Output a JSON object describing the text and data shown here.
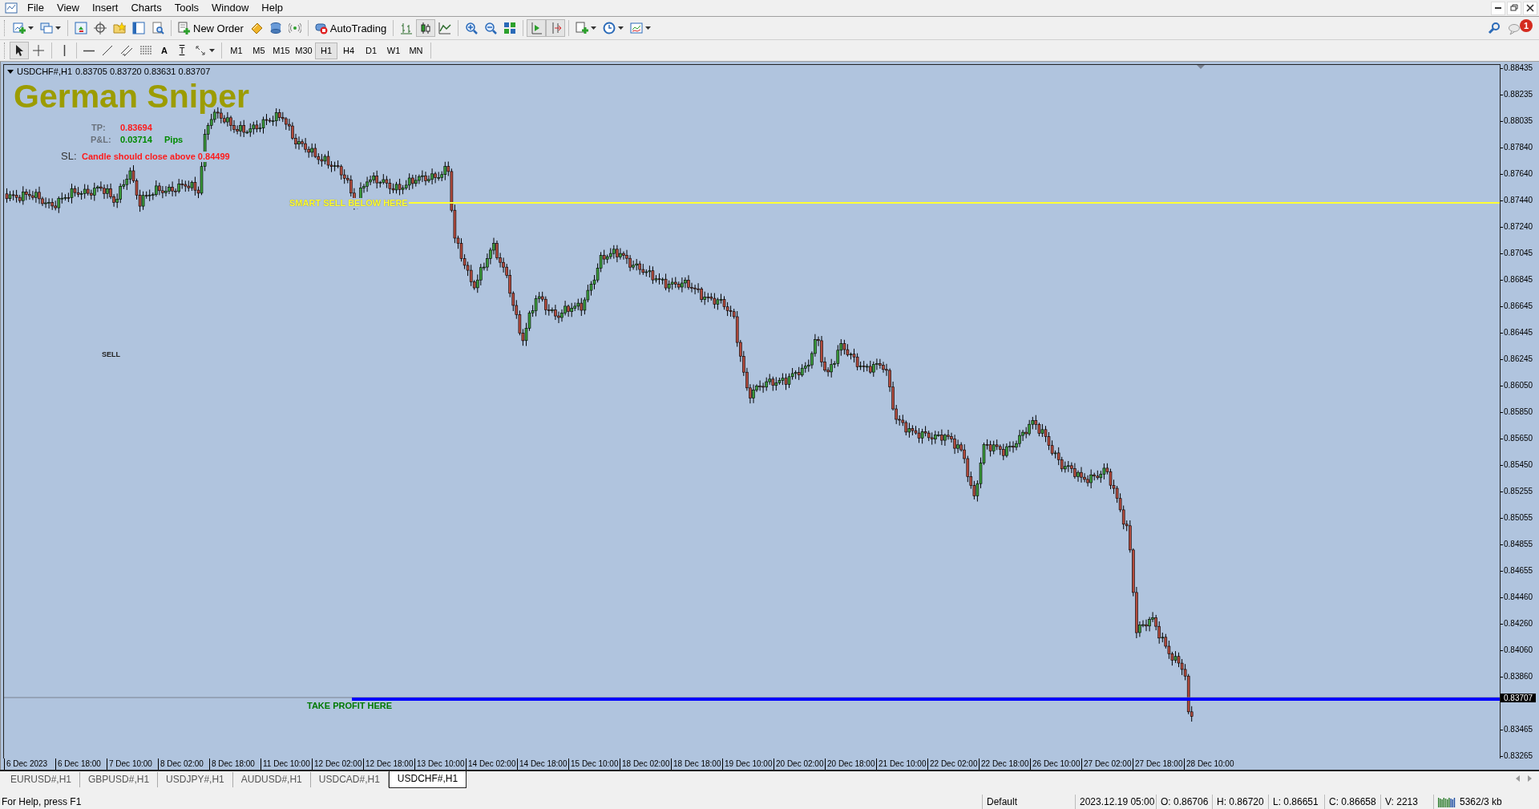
{
  "menu": [
    "File",
    "View",
    "Insert",
    "Charts",
    "Tools",
    "Window",
    "Help"
  ],
  "toolbar": [
    {
      "kind": "new-chart",
      "dropdown": true,
      "selected": false
    },
    {
      "kind": "profiles",
      "dropdown": true,
      "selected": false
    },
    {
      "kind": "market-watch",
      "selected": false
    },
    {
      "kind": "navigator",
      "selected": false
    },
    {
      "kind": "favorites",
      "selected": false
    },
    {
      "kind": "terminal",
      "selected": false
    },
    {
      "kind": "tester",
      "selected": false
    },
    {
      "kind": "new-order",
      "label": "New Order",
      "selected": false
    },
    {
      "kind": "editor",
      "selected": false
    },
    {
      "kind": "community",
      "selected": false
    },
    {
      "kind": "signals",
      "selected": false
    },
    {
      "kind": "autotrading",
      "label": "AutoTrading",
      "selected": false
    },
    {
      "kind": "bar-chart",
      "selected": false
    },
    {
      "kind": "candle-chart",
      "selected": true
    },
    {
      "kind": "line-chart",
      "selected": false
    },
    {
      "kind": "zoom-in",
      "selected": false
    },
    {
      "kind": "zoom-out",
      "selected": false
    },
    {
      "kind": "tile",
      "selected": false
    },
    {
      "kind": "autoscroll",
      "selected": true
    },
    {
      "kind": "chart-shift",
      "selected": true
    },
    {
      "kind": "indicators",
      "dropdown": true,
      "selected": false
    },
    {
      "kind": "periods",
      "dropdown": true,
      "selected": false
    },
    {
      "kind": "templates",
      "dropdown": true,
      "selected": false
    }
  ],
  "notifications": {
    "count": "1"
  },
  "drawing_tools": [
    {
      "kind": "cursor",
      "selected": true
    },
    {
      "kind": "crosshair",
      "selected": false
    },
    {
      "kind": "vline",
      "selected": false
    },
    {
      "kind": "hline",
      "selected": false
    },
    {
      "kind": "trendline",
      "selected": false
    },
    {
      "kind": "channel",
      "selected": false
    },
    {
      "kind": "fibo",
      "selected": false
    },
    {
      "kind": "text",
      "glyph": "A",
      "selected": false
    },
    {
      "kind": "label",
      "glyph": "T",
      "selected": false
    },
    {
      "kind": "arrows",
      "dropdown": true,
      "selected": false
    }
  ],
  "periods": [
    {
      "label": "M1",
      "selected": false
    },
    {
      "label": "M5",
      "selected": false
    },
    {
      "label": "M15",
      "selected": false
    },
    {
      "label": "M30",
      "selected": false
    },
    {
      "label": "H1",
      "selected": true
    },
    {
      "label": "H4",
      "selected": false
    },
    {
      "label": "D1",
      "selected": false
    },
    {
      "label": "W1",
      "selected": false
    },
    {
      "label": "MN",
      "selected": false
    }
  ],
  "chart": {
    "symbol": "USDCHF#,H1",
    "ohlc": "0.83705 0.83720 0.83631 0.83707",
    "indicator": {
      "title": "German Sniper",
      "tp_label": "TP:",
      "tp_value": "0.83694",
      "pnl_label": "P&L:",
      "pnl_value": "0.03714",
      "pnl_unit": "Pips",
      "sl_label": "SL:",
      "sl_text": "Candle should close above 0.84499"
    },
    "lines": [
      {
        "kind": "sell",
        "label": "SMART SELL BELOW HERE"
      },
      {
        "kind": "take-profit",
        "label": "TAKE PROFIT HERE"
      }
    ],
    "sell_marker": "SELL",
    "price_axis": [
      "0.88435",
      "0.88235",
      "0.88035",
      "0.87840",
      "0.87640",
      "0.87440",
      "0.87240",
      "0.87045",
      "0.86845",
      "0.86645",
      "0.86445",
      "0.86245",
      "0.86050",
      "0.85850",
      "0.85650",
      "0.85450",
      "0.85255",
      "0.85055",
      "0.84855",
      "0.84655",
      "0.84460",
      "0.84260",
      "0.84060",
      "0.83860",
      "0.83465",
      "0.83265"
    ],
    "current_price": "0.83707",
    "time_axis": [
      "6 Dec 2023",
      "6 Dec 18:00",
      "7 Dec 10:00",
      "8 Dec 02:00",
      "8 Dec 18:00",
      "11 Dec 10:00",
      "12 Dec 02:00",
      "12 Dec 18:00",
      "13 Dec 10:00",
      "14 Dec 02:00",
      "14 Dec 18:00",
      "15 Dec 10:00",
      "18 Dec 02:00",
      "18 Dec 18:00",
      "19 Dec 10:00",
      "20 Dec 02:00",
      "20 Dec 18:00",
      "21 Dec 10:00",
      "22 Dec 02:00",
      "22 Dec 18:00",
      "26 Dec 10:00",
      "27 Dec 02:00",
      "27 Dec 18:00",
      "28 Dec 10:00"
    ]
  },
  "tabs": [
    {
      "label": "EURUSD#,H1",
      "selected": false
    },
    {
      "label": "GBPUSD#,H1",
      "selected": false
    },
    {
      "label": "USDJPY#,H1",
      "selected": false
    },
    {
      "label": "AUDUSD#,H1",
      "selected": false
    },
    {
      "label": "USDCAD#,H1",
      "selected": false
    },
    {
      "label": "USDCHF#,H1",
      "selected": true
    }
  ],
  "status_bar": {
    "help": "For Help, press F1",
    "profile": "Default",
    "time": "2023.12.19 05:00",
    "open": "O: 0.86706",
    "high": "H: 0.86720",
    "low": "L: 0.86651",
    "close": "C: 0.86658",
    "volume": "V: 2213",
    "traffic": "5362/3 kb"
  }
}
